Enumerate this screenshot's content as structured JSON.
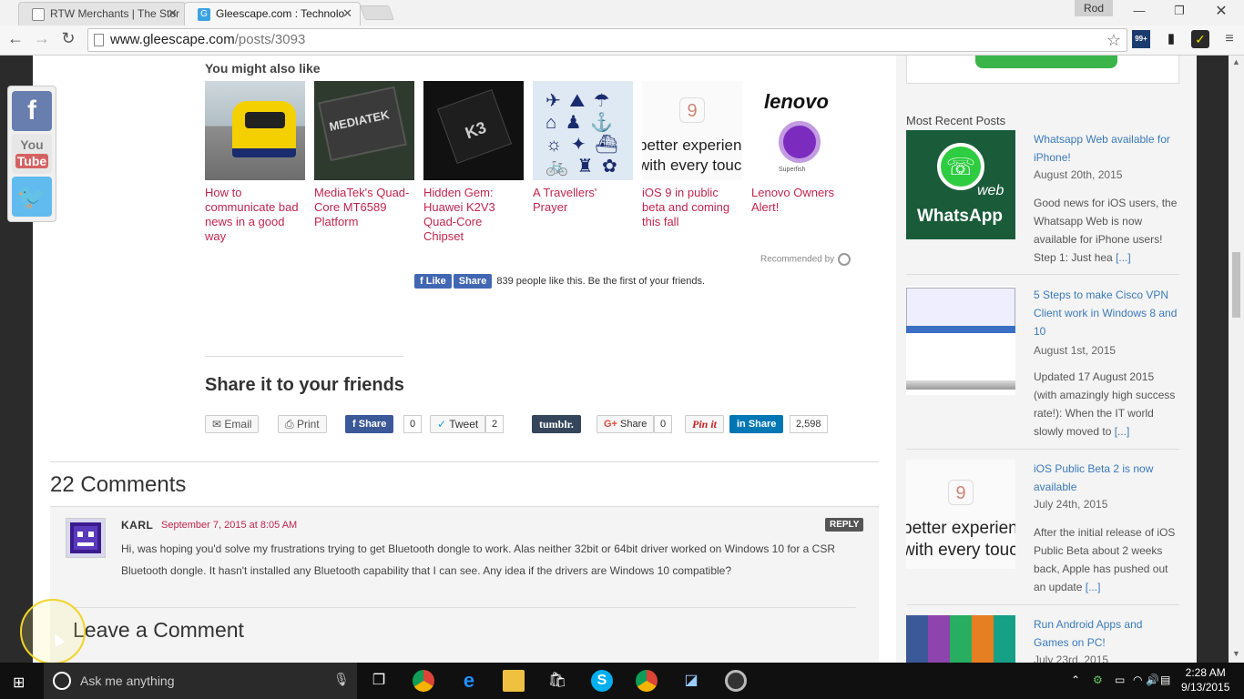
{
  "browser": {
    "tabs": [
      {
        "title": "RTW Merchants | The Stor",
        "active": false
      },
      {
        "title": "Gleescape.com : Technolo",
        "active": true
      }
    ],
    "user": "Rod",
    "url_host": "www.gleescape.com",
    "url_path": "/posts/3093",
    "ext_badge": "99+"
  },
  "related": {
    "title": "You might also like",
    "items": [
      {
        "caption": "How to communicate bad news in a good way"
      },
      {
        "caption": "MediaTek's Quad-Core MT6589 Platform",
        "image_text": "MEDIATEK"
      },
      {
        "caption": "Hidden Gem: Huawei K2V3 Quad-Core Chipset",
        "image_text": "K3"
      },
      {
        "caption": "A Travellers' Prayer"
      },
      {
        "caption": "iOS 9 in public beta and coming this fall",
        "image_text": "better experien with every toucl",
        "image_num": "9"
      },
      {
        "caption": "Lenovo Owners Alert!",
        "image_text": "lenovo",
        "image_sub": "Superfish"
      }
    ],
    "recommended_by": "Recommended by"
  },
  "facebook": {
    "like": "Like",
    "share": "Share",
    "text": "839 people like this. Be the first of your friends."
  },
  "share": {
    "title": "Share it to your friends",
    "email": "Email",
    "print": "Print",
    "fb_share": "Share",
    "fb_count": "0",
    "tweet": "Tweet",
    "tweet_count": "2",
    "tumblr": "tumblr.",
    "gplus": "Share",
    "gplus_count": "0",
    "pinit": "Pin it",
    "linkedin": "Share",
    "linkedin_count": "2,598"
  },
  "comments": {
    "title": "22 Comments",
    "items": [
      {
        "author": "KARL",
        "date": "September 7, 2015 at 8:05 AM",
        "reply": "REPLY",
        "text": "Hi, was hoping you'd solve my frustrations trying to get Bluetooth dongle to work. Alas neither 32bit or 64bit driver worked on Windows 10 for a CSR Bluetooth dongle. It hasn't installed any Bluetooth capability that I can see. Any idea if the drivers are Windows 10 compatible?"
      }
    ],
    "leave": "Leave a Comment"
  },
  "sidebar": {
    "title": "Most Recent Posts",
    "posts": [
      {
        "title": "Whatsapp Web available for iPhone!",
        "date": "August 20th, 2015",
        "excerpt": "Good news for iOS users, the Whatsapp Web is now available for iPhone users! Step 1: Just hea",
        "more": "[...]",
        "image_text": "WhatsApp",
        "image_sub": "web"
      },
      {
        "title": "5 Steps to make Cisco VPN Client work in Windows 8 and 10",
        "date": "August 1st, 2015",
        "excerpt": "Updated 17 August 2015 (with amazingly high success rate!): When the IT world slowly moved to",
        "more": "[...]"
      },
      {
        "title": "iOS Public Beta 2 is now available",
        "date": "July 24th, 2015",
        "excerpt": "After the initial release of iOS Public Beta about 2 weeks back, Apple has pushed out an update",
        "more": "[...]",
        "image_text": "better experien with every toucl",
        "image_num": "9"
      },
      {
        "title": "Run Android Apps and Games on PC!",
        "date": "July 23rd, 2015"
      }
    ]
  },
  "taskbar": {
    "search_placeholder": "Ask me anything",
    "time": "2:28 AM",
    "date": "9/13/2015"
  },
  "colors": {
    "link_red": "#c0254e",
    "link_blue": "#3a7ab8",
    "fb_blue": "#4267b2"
  }
}
